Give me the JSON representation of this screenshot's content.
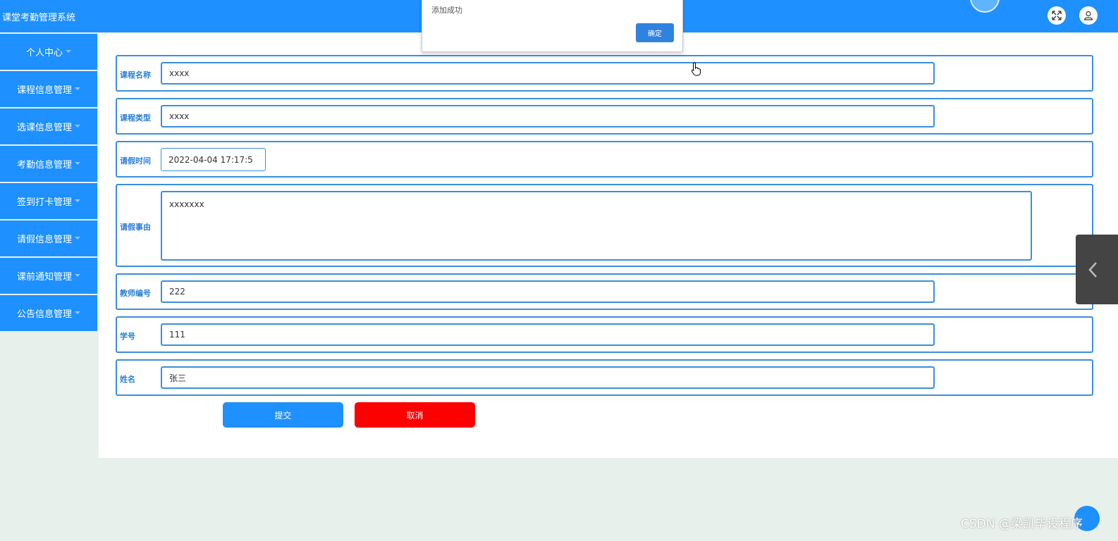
{
  "app": {
    "title": "课堂考勤管理系统"
  },
  "header": {
    "fullscreen_icon": "expand-icon",
    "user_icon": "user-icon"
  },
  "sidebar": {
    "items": [
      {
        "label": "个人中心"
      },
      {
        "label": "课程信息管理"
      },
      {
        "label": "选课信息管理"
      },
      {
        "label": "考勤信息管理"
      },
      {
        "label": "签到打卡管理"
      },
      {
        "label": "请假信息管理"
      },
      {
        "label": "课前通知管理"
      },
      {
        "label": "公告信息管理"
      }
    ]
  },
  "form": {
    "course_name": {
      "label": "课程名称",
      "value": "xxxx"
    },
    "course_type": {
      "label": "课程类型",
      "value": "xxxx"
    },
    "leave_time": {
      "label": "请假时间",
      "value": "2022-04-04 17:17:5"
    },
    "leave_reason": {
      "label": "请假事由",
      "value": "xxxxxxx"
    },
    "teacher_id": {
      "label": "教师编号",
      "value": "222"
    },
    "student_id": {
      "label": "学号",
      "value": "111"
    },
    "name": {
      "label": "姓名",
      "value": "张三"
    },
    "submit_label": "提交",
    "cancel_label": "取消"
  },
  "dialog": {
    "message": "添加成功",
    "ok_label": "确定"
  },
  "watermark": "CSDN @梁凯毕设程序",
  "colors": {
    "primary": "#1e90ff",
    "border": "#3b8fdc",
    "cancel": "#ff0000",
    "background": "#e8f0ec"
  }
}
